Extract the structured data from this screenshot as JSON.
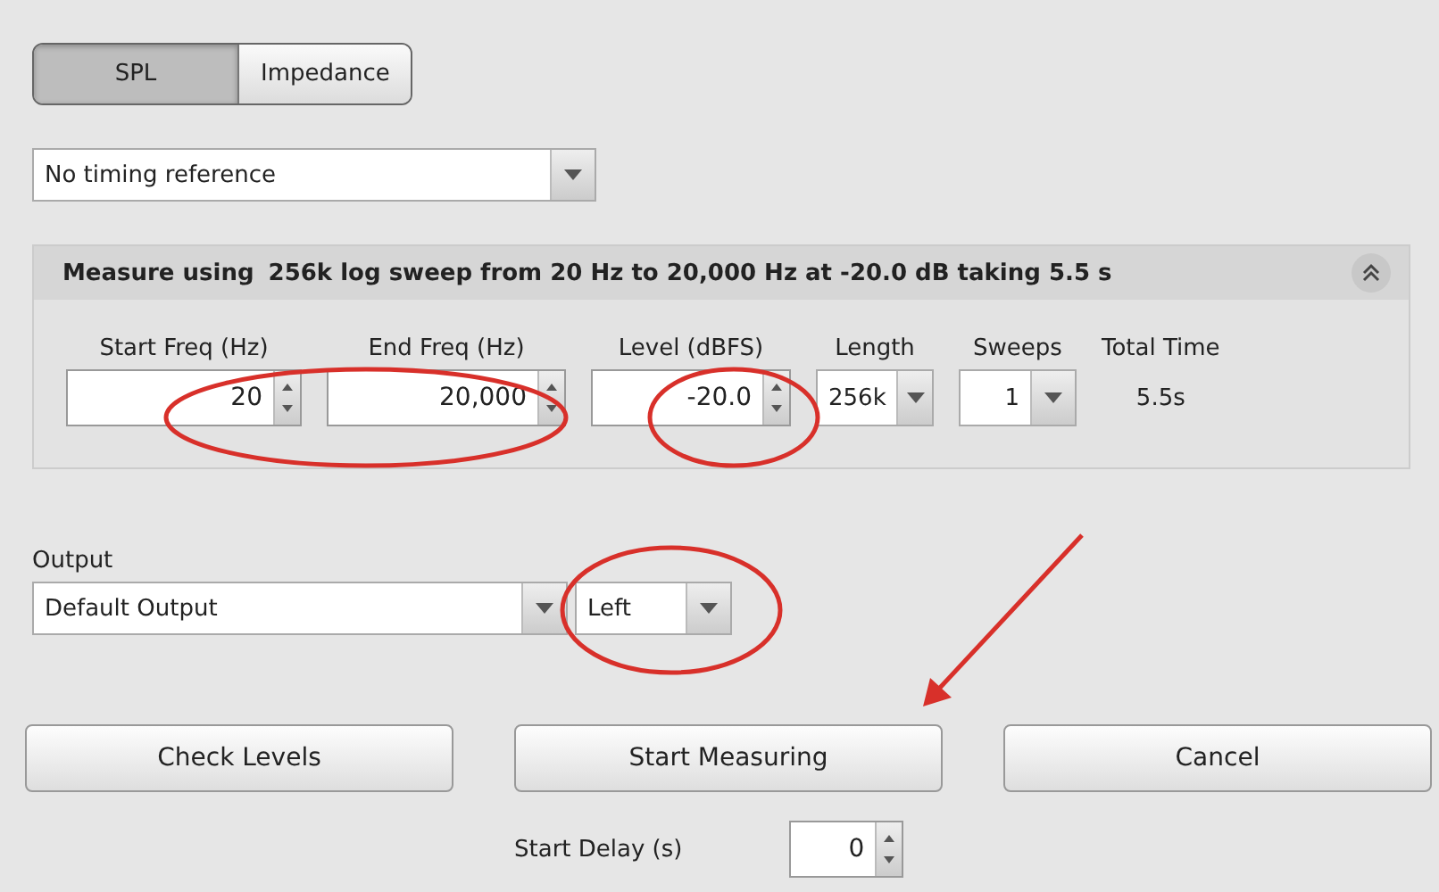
{
  "tabs": [
    {
      "label": "SPL",
      "selected": true
    },
    {
      "label": "Impedance",
      "selected": false
    }
  ],
  "timing_reference": {
    "value": "No timing reference"
  },
  "measure_panel": {
    "title": "Measure using",
    "summary": "256k log sweep from 20 Hz to 20,000 Hz at -20.0 dB taking 5.5 s",
    "fields": [
      {
        "kind": "spinner",
        "label": "Start Freq (Hz)",
        "value": "20"
      },
      {
        "kind": "spinner",
        "label": "End Freq (Hz)",
        "value": "20,000"
      },
      {
        "kind": "spinner",
        "label": "Level (dBFS)",
        "value": "-20.0"
      },
      {
        "kind": "dropdown",
        "label": "Length",
        "value": "256k"
      },
      {
        "kind": "dropdown",
        "label": "Sweeps",
        "value": "1"
      },
      {
        "kind": "readout",
        "label": "Total Time",
        "value": "5.5s"
      }
    ]
  },
  "output": {
    "label": "Output",
    "device": "Default Output",
    "channel": "Left"
  },
  "buttons": [
    "Check Levels",
    "Start Measuring",
    "Cancel"
  ],
  "start_delay": {
    "label": "Start Delay (s)",
    "value": "0"
  }
}
